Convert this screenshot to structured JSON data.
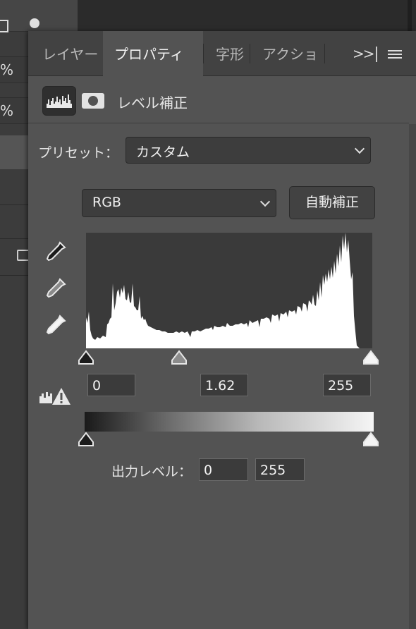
{
  "tabs": [
    {
      "label": "レイヤー",
      "active": false
    },
    {
      "label": "プロパティ",
      "active": true
    },
    {
      "label": "字形",
      "active": false
    },
    {
      "label": "アクショ",
      "active": false
    }
  ],
  "tab_overflow": ">>",
  "header": {
    "title": "レベル補正",
    "icons": [
      "histogram-icon",
      "mask-icon"
    ]
  },
  "preset": {
    "label": "プリセット：",
    "value": "カスタム"
  },
  "channel": {
    "value": "RGB"
  },
  "auto_button": "自動補正",
  "input_levels": {
    "black": "0",
    "gamma": "1.62",
    "white": "255"
  },
  "output": {
    "label": "出力レベル：",
    "black": "0",
    "white": "255"
  },
  "background_rows": [
    "%",
    "%"
  ],
  "colors": {
    "panel": "#535353",
    "tabbar": "#424242",
    "field": "#3b3b3b",
    "histogram_bg": "#3a3a3a",
    "histogram_fg": "#ffffff",
    "warning": "#ffffff"
  }
}
